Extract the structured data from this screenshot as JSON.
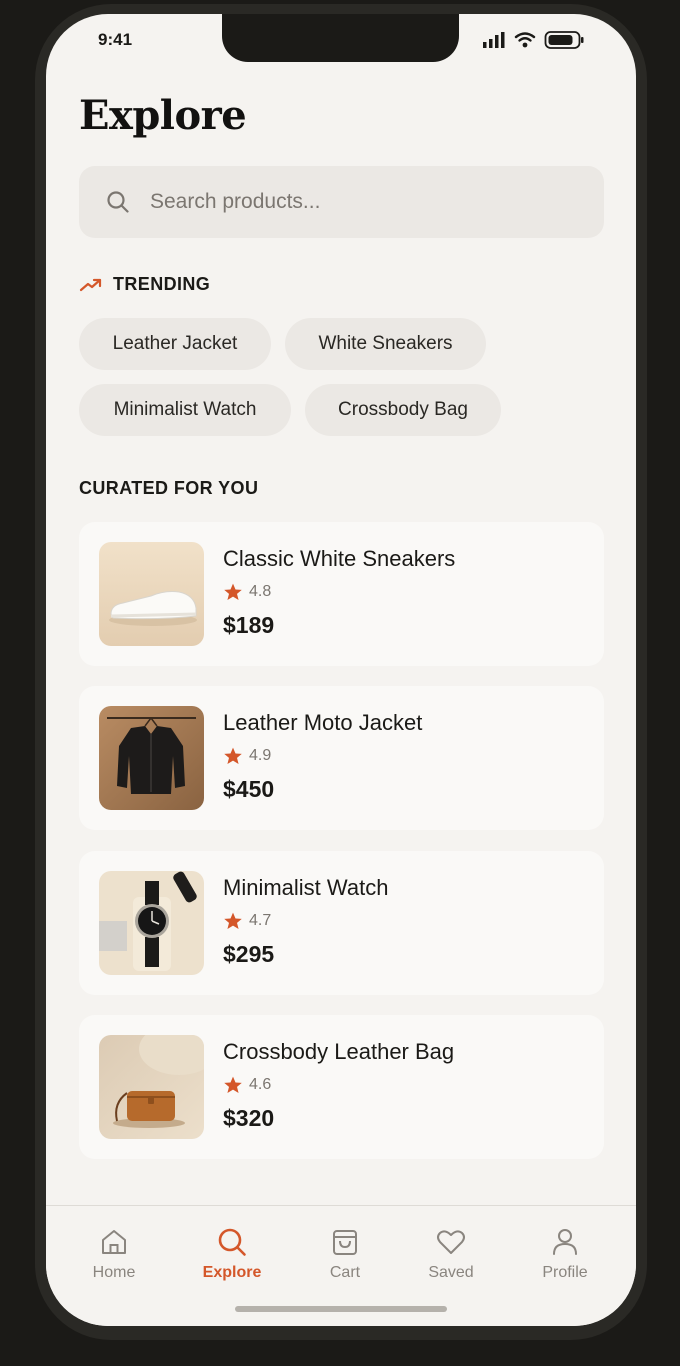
{
  "status": {
    "time": "9:41"
  },
  "page": {
    "title": "Explore"
  },
  "search": {
    "placeholder": "Search products..."
  },
  "trending": {
    "label": "TRENDING",
    "chips": [
      "Leather Jacket",
      "White Sneakers",
      "Minimalist Watch",
      "Crossbody Bag"
    ]
  },
  "curated": {
    "label": "CURATED FOR YOU",
    "products": [
      {
        "name": "Classic White Sneakers",
        "rating": "4.8",
        "price": "$189",
        "image": "white-sneaker-photo"
      },
      {
        "name": "Leather Moto Jacket",
        "rating": "4.9",
        "price": "$450",
        "image": "leather-jacket-photo"
      },
      {
        "name": "Minimalist Watch",
        "rating": "4.7",
        "price": "$295",
        "image": "watch-photo"
      },
      {
        "name": "Crossbody Leather Bag",
        "rating": "4.6",
        "price": "$320",
        "image": "crossbody-bag-photo"
      }
    ]
  },
  "tabbar": {
    "tabs": [
      {
        "label": "Home",
        "icon": "home-icon",
        "active": false
      },
      {
        "label": "Explore",
        "icon": "search-icon",
        "active": true
      },
      {
        "label": "Cart",
        "icon": "shopping-bag-icon",
        "active": false
      },
      {
        "label": "Saved",
        "icon": "heart-icon",
        "active": false
      },
      {
        "label": "Profile",
        "icon": "person-icon",
        "active": false
      }
    ]
  },
  "colors": {
    "accent": "#d4572a",
    "background": "#f5f3f0",
    "chip": "#ebe8e4",
    "card": "#faf9f7",
    "text": "#1b1a17"
  }
}
